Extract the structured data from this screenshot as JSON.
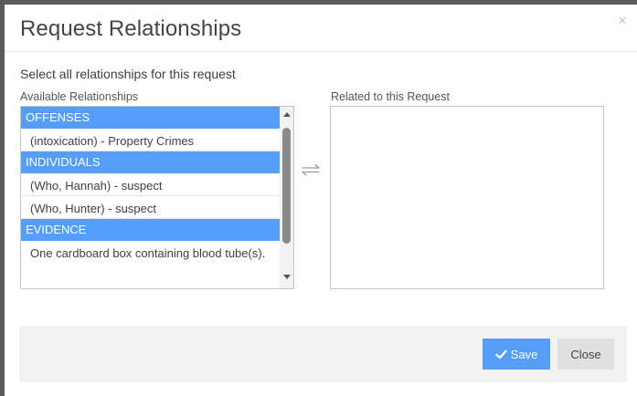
{
  "modal": {
    "title": "Request Relationships",
    "close_glyph": "×",
    "instruction": "Select all relationships for this request"
  },
  "available": {
    "label": "Available Relationships",
    "groups": [
      {
        "header": "OFFENSES",
        "items": [
          "(intoxication) - Property Crimes"
        ]
      },
      {
        "header": "INDIVIDUALS",
        "items": [
          "(Who, Hannah) - suspect",
          "(Who, Hunter) - suspect"
        ]
      },
      {
        "header": "EVIDENCE",
        "items": [
          "One cardboard box containing blood tube(s)."
        ]
      }
    ]
  },
  "related": {
    "label": "Related to this Request"
  },
  "footer": {
    "save_label": "Save",
    "close_label": "Close"
  },
  "colors": {
    "accent": "#569df8",
    "footer_bg": "#f2f2f2",
    "close_button_bg": "#e0e0e0"
  },
  "icons": {
    "close": "close-x-icon",
    "transfer": "left-right-arrows-icon",
    "save": "checkmark-icon"
  }
}
